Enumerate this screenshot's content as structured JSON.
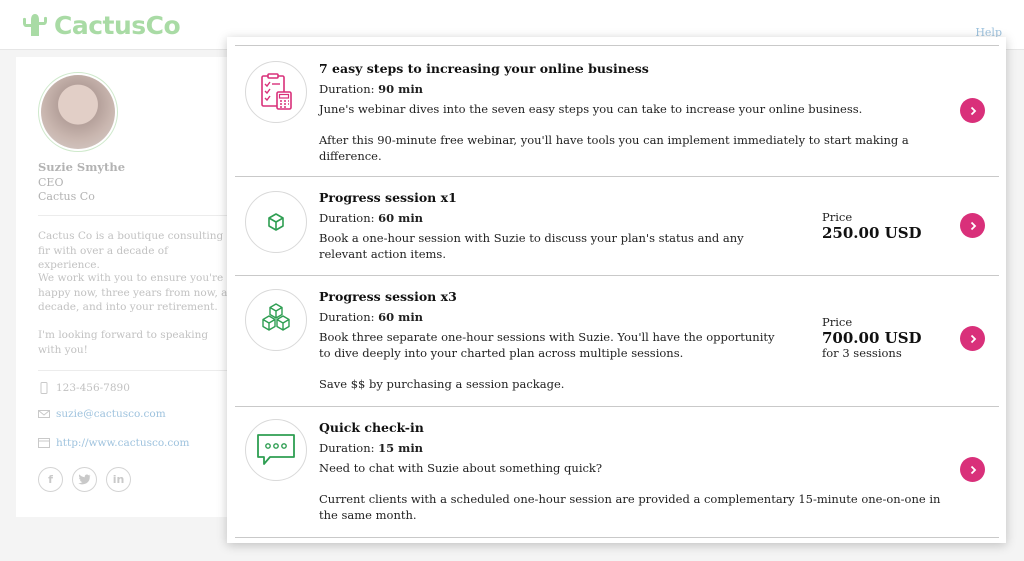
{
  "header": {
    "logo_text": "CactusCo",
    "help_label": "Help"
  },
  "profile": {
    "name": "Suzie Smythe",
    "title": "CEO",
    "company": "Cactus Co",
    "bio": [
      "Cactus Co is a boutique consulting fir with over a decade of experience.",
      "We work with you to ensure you're happy now, three years from now, a decade, and into your retirement.",
      "I'm looking forward to speaking with you!"
    ],
    "phone": "123-456-7890",
    "email": "suzie@cactusco.com",
    "website": "http://www.cactusco.com",
    "socials": [
      "facebook-icon",
      "twitter-icon",
      "linkedin-icon"
    ]
  },
  "services": [
    {
      "icon": "checklist-calculator-icon",
      "title": "7 easy steps to increasing your online business",
      "duration_label": "Duration:",
      "duration": "90 min",
      "description": "June's webinar dives into the seven easy steps you can take to increase your online business.",
      "extra": "After this 90-minute free webinar, you'll have tools you can implement immediately to start making a difference."
    },
    {
      "icon": "single-box-icon",
      "title": "Progress session x1",
      "duration_label": "Duration:",
      "duration": "60 min",
      "description": "Book a one-hour session with Suzie to discuss your plan's status and any relevant action items.",
      "price_label": "Price",
      "price": "250.00 USD"
    },
    {
      "icon": "stacked-boxes-icon",
      "title": "Progress session x3",
      "duration_label": "Duration:",
      "duration": "60 min",
      "description": "Book three separate one-hour sessions with Suzie. You'll have the opportunity to dive deeply into your charted plan across multiple sessions.",
      "extra": "Save $$ by purchasing a session package.",
      "price_label": "Price",
      "price": "700.00 USD",
      "price_note": "for 3 sessions"
    },
    {
      "icon": "chat-bubble-icon",
      "title": "Quick check-in",
      "duration_label": "Duration:",
      "duration": "15 min",
      "description": "Need to chat with Suzie about something quick?",
      "extra": "Current clients with a scheduled one-hour session are provided a complementary 15-minute one-on-one in the same month."
    }
  ],
  "colors": {
    "accent_button": "#d9307a",
    "icon_pink": "#d9307a",
    "icon_green": "#2e9e52",
    "logo_green": "#a9dba5",
    "link_blue": "#9fc3de"
  }
}
